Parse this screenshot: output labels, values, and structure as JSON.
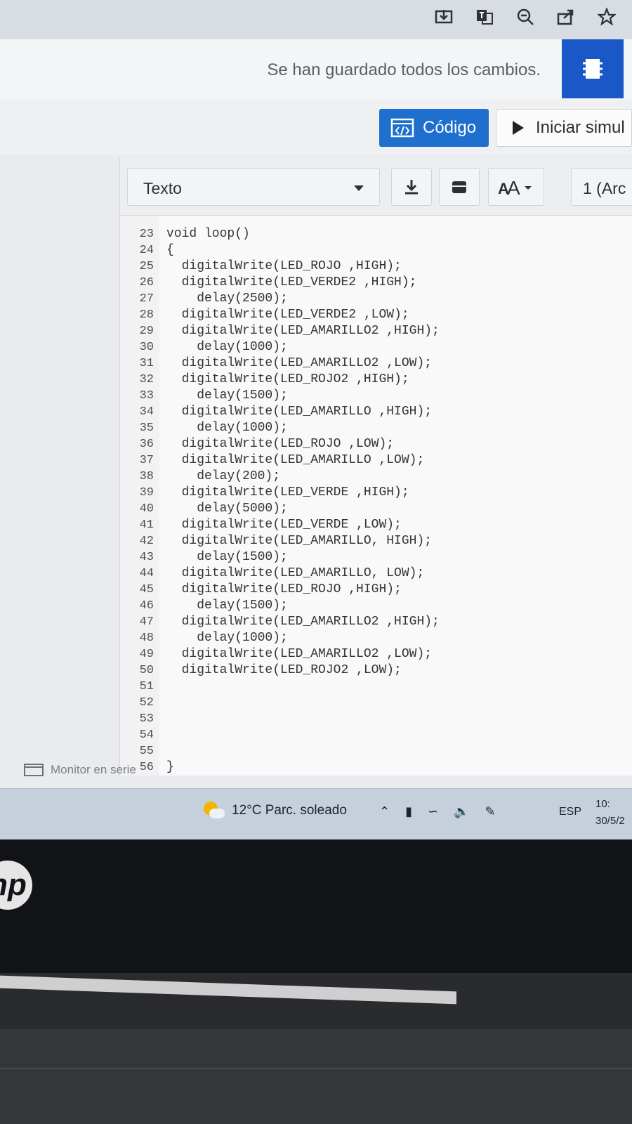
{
  "browser": {
    "icons": [
      "install-icon",
      "translate-icon",
      "zoom-icon",
      "share-icon",
      "bookmark-star-icon"
    ]
  },
  "header": {
    "save_status": "Se han guardado todos los cambios."
  },
  "toolbar": {
    "code_label": "Código",
    "simulate_label": "Iniciar simul"
  },
  "editor": {
    "mode_select": "Texto",
    "port_select": "1 (Arc",
    "lines": [
      {
        "n": "23",
        "t": "void loop()"
      },
      {
        "n": "24",
        "t": "{"
      },
      {
        "n": "25",
        "t": "  digitalWrite(LED_ROJO ,HIGH);"
      },
      {
        "n": "26",
        "t": "  digitalWrite(LED_VERDE2 ,HIGH);"
      },
      {
        "n": "27",
        "t": "    delay(2500);"
      },
      {
        "n": "28",
        "t": "  digitalWrite(LED_VERDE2 ,LOW);"
      },
      {
        "n": "29",
        "t": "  digitalWrite(LED_AMARILLO2 ,HIGH);"
      },
      {
        "n": "30",
        "t": "    delay(1000);"
      },
      {
        "n": "31",
        "t": "  digitalWrite(LED_AMARILLO2 ,LOW);"
      },
      {
        "n": "32",
        "t": "  digitalWrite(LED_ROJO2 ,HIGH);"
      },
      {
        "n": "33",
        "t": "    delay(1500);"
      },
      {
        "n": "34",
        "t": "  digitalWrite(LED_AMARILLO ,HIGH);"
      },
      {
        "n": "35",
        "t": "    delay(1000);"
      },
      {
        "n": "36",
        "t": "  digitalWrite(LED_ROJO ,LOW);"
      },
      {
        "n": "37",
        "t": "  digitalWrite(LED_AMARILLO ,LOW);"
      },
      {
        "n": "38",
        "t": "    delay(200);"
      },
      {
        "n": "39",
        "t": "  digitalWrite(LED_VERDE ,HIGH);"
      },
      {
        "n": "40",
        "t": "    delay(5000);"
      },
      {
        "n": "41",
        "t": "  digitalWrite(LED_VERDE ,LOW);"
      },
      {
        "n": "42",
        "t": "  digitalWrite(LED_AMARILLO, HIGH);"
      },
      {
        "n": "43",
        "t": "    delay(1500);"
      },
      {
        "n": "44",
        "t": "  digitalWrite(LED_AMARILLO, LOW);"
      },
      {
        "n": "45",
        "t": "  digitalWrite(LED_ROJO ,HIGH);"
      },
      {
        "n": "46",
        "t": "    delay(1500);"
      },
      {
        "n": "47",
        "t": "  digitalWrite(LED_AMARILLO2 ,HIGH);"
      },
      {
        "n": "48",
        "t": "    delay(1000);"
      },
      {
        "n": "49",
        "t": "  digitalWrite(LED_AMARILLO2 ,LOW);"
      },
      {
        "n": "50",
        "t": "  digitalWrite(LED_ROJO2 ,LOW);"
      },
      {
        "n": "51",
        "t": ""
      },
      {
        "n": "52",
        "t": ""
      },
      {
        "n": "53",
        "t": ""
      },
      {
        "n": "54",
        "t": ""
      },
      {
        "n": "55",
        "t": ""
      },
      {
        "n": "56",
        "t": "}"
      }
    ],
    "serial_monitor": "Monitor en serie"
  },
  "taskbar": {
    "weather": "12°C  Parc. soleado",
    "language": "ESP",
    "time": "10:",
    "date": "30/5/2"
  },
  "laptop": {
    "logo": "hp"
  }
}
